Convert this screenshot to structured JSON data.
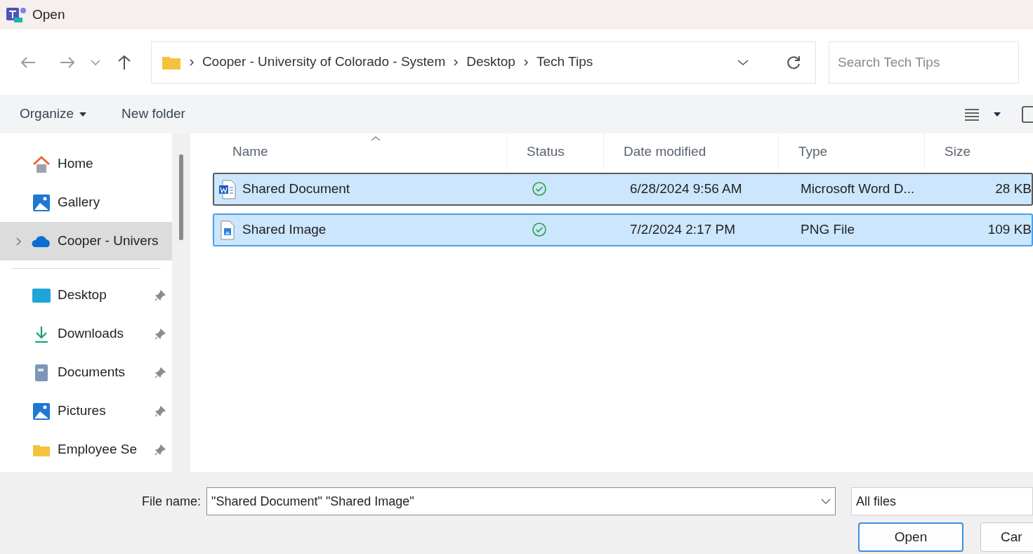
{
  "window": {
    "title": "Open"
  },
  "address": {
    "path": [
      "Cooper - University of Colorado - System",
      "Desktop",
      "Tech Tips"
    ]
  },
  "search": {
    "placeholder": "Search Tech Tips"
  },
  "toolbar": {
    "organize": "Organize",
    "new_folder": "New folder"
  },
  "sidebar": {
    "items": [
      {
        "kind": "home",
        "label": "Home",
        "selected": false,
        "pinned": false,
        "expandable": false
      },
      {
        "kind": "gallery",
        "label": "Gallery",
        "selected": false,
        "pinned": false,
        "expandable": false
      },
      {
        "kind": "cloud",
        "label": "Cooper - Univers",
        "selected": true,
        "pinned": false,
        "expandable": true
      },
      {
        "kind": "separator"
      },
      {
        "kind": "desktop",
        "label": "Desktop",
        "selected": false,
        "pinned": true,
        "expandable": false
      },
      {
        "kind": "downloads",
        "label": "Downloads",
        "selected": false,
        "pinned": true,
        "expandable": false
      },
      {
        "kind": "documents",
        "label": "Documents",
        "selected": false,
        "pinned": true,
        "expandable": false
      },
      {
        "kind": "pictures",
        "label": "Pictures",
        "selected": false,
        "pinned": true,
        "expandable": false
      },
      {
        "kind": "folder",
        "label": "Employee Se",
        "selected": false,
        "pinned": true,
        "expandable": false
      }
    ]
  },
  "table": {
    "columns": [
      "Name",
      "Status",
      "Date modified",
      "Type",
      "Size"
    ],
    "rows": [
      {
        "kind": "word",
        "name": "Shared Document",
        "synced": true,
        "date": "6/28/2024 9:56 AM",
        "type": "Microsoft Word D...",
        "size": "28 KB",
        "selected": true,
        "focused": true
      },
      {
        "kind": "image",
        "name": "Shared Image",
        "synced": true,
        "date": "7/2/2024 2:17 PM",
        "type": "PNG File",
        "size": "109 KB",
        "selected": true,
        "focused": false
      }
    ]
  },
  "footer": {
    "file_name_label": "File name:",
    "file_name": "\"Shared Document\" \"Shared Image\"",
    "filter": "All files",
    "buttons": [
      "Open",
      "Car"
    ]
  }
}
